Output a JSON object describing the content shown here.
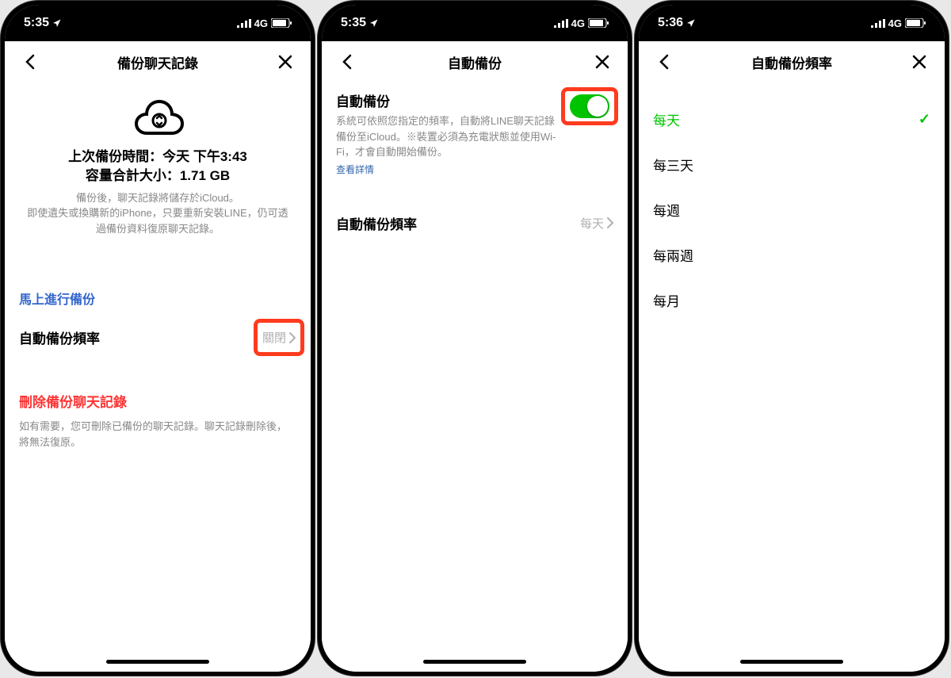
{
  "status": {
    "time1": "5:35",
    "time2": "5:35",
    "time3": "5:36",
    "network": "4G"
  },
  "screen1": {
    "title": "備份聊天記錄",
    "last_backup": "上次備份時間：今天 下午3:43",
    "size": "容量合計大小：1.71 GB",
    "desc": "備份後，聊天記錄將儲存於iCloud。\n即使遺失或換購新的iPhone，只要重新安裝LINE，仍可透過備份資料復原聊天記錄。",
    "backup_now": "馬上進行備份",
    "auto_freq_label": "自動備份頻率",
    "auto_freq_value": "關閉",
    "delete_label": "刪除備份聊天記錄",
    "delete_desc": "如有需要，您可刪除已備份的聊天記錄。聊天記錄刪除後，將無法復原。"
  },
  "screen2": {
    "title": "自動備份",
    "toggle_label": "自動備份",
    "toggle_desc": "系統可依照您指定的頻率，自動將LINE聊天記錄備份至iCloud。※裝置必須為充電狀態並使用Wi-Fi，才會自動開始備份。",
    "toggle_link": "查看詳情",
    "freq_label": "自動備份頻率",
    "freq_value": "每天"
  },
  "screen3": {
    "title": "自動備份頻率",
    "options": [
      "每天",
      "每三天",
      "每週",
      "每兩週",
      "每月"
    ],
    "selected_index": 0
  }
}
